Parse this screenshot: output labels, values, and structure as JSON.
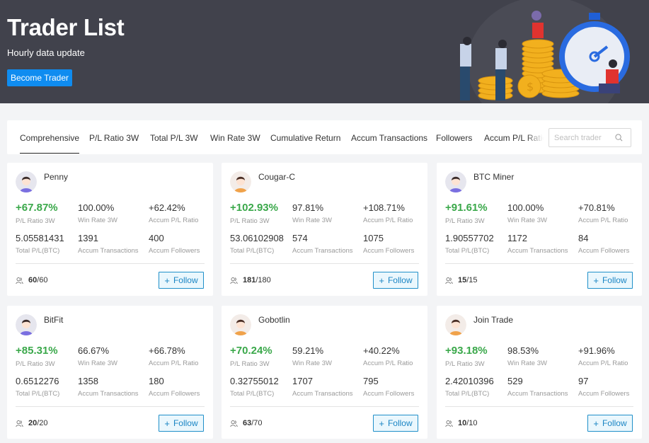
{
  "hero": {
    "title": "Trader List",
    "subtitle": "Hourly data update",
    "button_label": "Become Trader",
    "accent_color": "#0f8cf0"
  },
  "tabs": [
    {
      "label": "Comprehensive",
      "active": true
    },
    {
      "label": "P/L Ratio 3W",
      "active": false
    },
    {
      "label": "Total P/L 3W",
      "active": false
    },
    {
      "label": "Win Rate 3W",
      "active": false
    },
    {
      "label": "Cumulative Return",
      "active": false
    },
    {
      "label": "Accum Transactions",
      "active": false
    },
    {
      "label": "Followers",
      "active": false
    },
    {
      "label": "Accum P/L Ratio",
      "active": false
    }
  ],
  "search": {
    "placeholder": "Search trader",
    "value": "",
    "icon": "search-icon"
  },
  "labels": {
    "pl_ratio_3w": "P/L Ratio 3W",
    "win_rate_3w": "Win Rate 3W",
    "accum_pl_ratio": "Accum P/L Ratio",
    "total_pl_btc": "Total P/L(BTC)",
    "accum_transactions": "Accum Transactions",
    "accum_followers": "Accum Followers",
    "follow_button": "Follow",
    "follow_icon": "plus-icon",
    "copy_slots_icon": "users-icon"
  },
  "colors": {
    "positive": "#3aa84a",
    "follow_border": "#1f8fc9",
    "follow_bg": "#eaf7fd"
  },
  "traders": [
    {
      "name": "Penny",
      "avatar": "avatar-purple",
      "pl_ratio_3w": "+67.87%",
      "win_rate_3w": "100.00%",
      "accum_pl_ratio": "+62.42%",
      "total_pl_btc": "5.05581431",
      "accum_transactions": "1391",
      "accum_followers": "400",
      "slots_used": "60",
      "slots_total": "/60"
    },
    {
      "name": "Cougar-C",
      "avatar": "avatar-orange",
      "pl_ratio_3w": "+102.93%",
      "win_rate_3w": "97.81%",
      "accum_pl_ratio": "+108.71%",
      "total_pl_btc": "53.06102908",
      "accum_transactions": "574",
      "accum_followers": "1075",
      "slots_used": "181",
      "slots_total": "/180"
    },
    {
      "name": "BTC Miner",
      "avatar": "avatar-purple",
      "pl_ratio_3w": "+91.61%",
      "win_rate_3w": "100.00%",
      "accum_pl_ratio": "+70.81%",
      "total_pl_btc": "1.90557702",
      "accum_transactions": "1172",
      "accum_followers": "84",
      "slots_used": "15",
      "slots_total": "/15"
    },
    {
      "name": "BitFit",
      "avatar": "avatar-purple",
      "pl_ratio_3w": "+85.31%",
      "win_rate_3w": "66.67%",
      "accum_pl_ratio": "+66.78%",
      "total_pl_btc": "0.6512276",
      "accum_transactions": "1358",
      "accum_followers": "180",
      "slots_used": "20",
      "slots_total": "/20"
    },
    {
      "name": "Gobotlin",
      "avatar": "avatar-orange",
      "pl_ratio_3w": "+70.24%",
      "win_rate_3w": "59.21%",
      "accum_pl_ratio": "+40.22%",
      "total_pl_btc": "0.32755012",
      "accum_transactions": "1707",
      "accum_followers": "795",
      "slots_used": "63",
      "slots_total": "/70"
    },
    {
      "name": "Join Trade",
      "avatar": "avatar-orange",
      "pl_ratio_3w": "+93.18%",
      "win_rate_3w": "98.53%",
      "accum_pl_ratio": "+91.96%",
      "total_pl_btc": "2.42010396",
      "accum_transactions": "529",
      "accum_followers": "97",
      "slots_used": "10",
      "slots_total": "/10"
    }
  ]
}
